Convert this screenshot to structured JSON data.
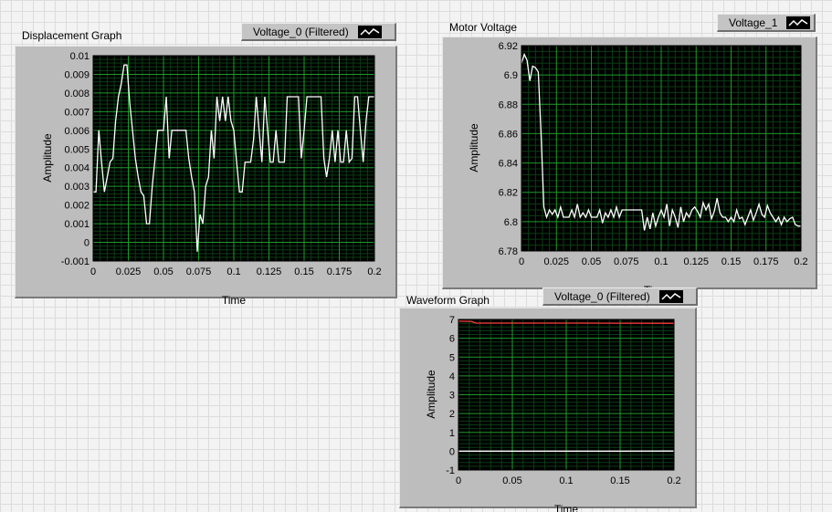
{
  "graphs": [
    {
      "id": "displacement",
      "title": "Displacement Graph",
      "legend_label": "Voltage_0 (Filtered)",
      "xlabel": "Time",
      "ylabel": "Amplitude",
      "xlim": [
        0,
        0.2
      ],
      "ylim": [
        -0.001,
        0.01
      ],
      "xticks": [
        "0",
        "0.025",
        "0.05",
        "0.075",
        "0.1",
        "0.125",
        "0.15",
        "0.175",
        "0.2"
      ],
      "yticks": [
        "-0.001",
        "0",
        "0.001",
        "0.002",
        "0.003",
        "0.004",
        "0.005",
        "0.006",
        "0.007",
        "0.008",
        "0.009",
        "0.01"
      ]
    },
    {
      "id": "motor",
      "title": "Motor Voltage",
      "legend_label": "Voltage_1",
      "xlabel": "Time",
      "ylabel": "Amplitude",
      "xlim": [
        0,
        0.2
      ],
      "ylim": [
        6.78,
        6.92
      ],
      "xticks": [
        "0",
        "0.025",
        "0.05",
        "0.075",
        "0.1",
        "0.125",
        "0.15",
        "0.175",
        "0.2"
      ],
      "yticks": [
        "6.78",
        "6.8",
        "6.82",
        "6.84",
        "6.86",
        "6.88",
        "6.9",
        "6.92"
      ]
    },
    {
      "id": "waveform",
      "title": "Waveform Graph",
      "legend_label": "Voltage_0 (Filtered)",
      "xlabel": "Time",
      "ylabel": "Amplitude",
      "xlim": [
        0,
        0.2
      ],
      "ylim": [
        -1,
        7
      ],
      "xticks": [
        "0",
        "0.05",
        "0.1",
        "0.15",
        "0.2"
      ],
      "yticks": [
        "-1",
        "0",
        "1",
        "2",
        "3",
        "4",
        "5",
        "6",
        "7"
      ]
    }
  ],
  "chart_data": [
    {
      "type": "line",
      "title": "Displacement Graph",
      "xlabel": "Time",
      "ylabel": "Amplitude",
      "xlim": [
        0,
        0.2
      ],
      "ylim": [
        -0.001,
        0.01
      ],
      "grid": true,
      "series": [
        {
          "name": "Voltage_0 (Filtered)",
          "color": "#ffffff",
          "x": [
            0,
            0.002,
            0.004,
            0.006,
            0.008,
            0.01,
            0.012,
            0.014,
            0.016,
            0.018,
            0.02,
            0.022,
            0.024,
            0.026,
            0.028,
            0.03,
            0.032,
            0.034,
            0.036,
            0.038,
            0.04,
            0.042,
            0.044,
            0.046,
            0.048,
            0.05,
            0.052,
            0.054,
            0.056,
            0.058,
            0.06,
            0.062,
            0.064,
            0.066,
            0.068,
            0.07,
            0.072,
            0.074,
            0.076,
            0.078,
            0.08,
            0.082,
            0.084,
            0.086,
            0.088,
            0.09,
            0.092,
            0.094,
            0.096,
            0.098,
            0.1,
            0.102,
            0.104,
            0.106,
            0.108,
            0.11,
            0.112,
            0.114,
            0.116,
            0.118,
            0.12,
            0.122,
            0.124,
            0.126,
            0.128,
            0.13,
            0.132,
            0.134,
            0.136,
            0.138,
            0.14,
            0.142,
            0.144,
            0.146,
            0.148,
            0.15,
            0.152,
            0.154,
            0.156,
            0.158,
            0.16,
            0.162,
            0.164,
            0.166,
            0.168,
            0.17,
            0.172,
            0.174,
            0.176,
            0.178,
            0.18,
            0.182,
            0.184,
            0.186,
            0.188,
            0.19,
            0.192,
            0.194,
            0.196,
            0.198,
            0.2
          ],
          "values": [
            0.0027,
            0.0027,
            0.006,
            0.0043,
            0.0027,
            0.0035,
            0.0043,
            0.0045,
            0.0065,
            0.0078,
            0.0085,
            0.0095,
            0.0095,
            0.0075,
            0.006,
            0.0045,
            0.0035,
            0.0027,
            0.0025,
            0.001,
            0.001,
            0.003,
            0.0045,
            0.006,
            0.006,
            0.006,
            0.0078,
            0.0045,
            0.006,
            0.006,
            0.006,
            0.006,
            0.006,
            0.006,
            0.0045,
            0.0035,
            0.0027,
            -0.0005,
            0.0015,
            0.001,
            0.003,
            0.0035,
            0.006,
            0.0045,
            0.0078,
            0.0065,
            0.0078,
            0.0065,
            0.0078,
            0.0065,
            0.006,
            0.0043,
            0.0027,
            0.0027,
            0.0043,
            0.0043,
            0.0043,
            0.0055,
            0.0078,
            0.006,
            0.0043,
            0.0078,
            0.006,
            0.0043,
            0.0043,
            0.006,
            0.0043,
            0.0043,
            0.0043,
            0.0078,
            0.0078,
            0.0078,
            0.0078,
            0.0078,
            0.0045,
            0.006,
            0.0078,
            0.0078,
            0.0078,
            0.0078,
            0.0078,
            0.0078,
            0.0045,
            0.0035,
            0.0045,
            0.006,
            0.0043,
            0.006,
            0.0043,
            0.0043,
            0.006,
            0.0043,
            0.0045,
            0.0078,
            0.0078,
            0.006,
            0.0043,
            0.0065,
            0.0078,
            0.0078,
            0.0078
          ]
        }
      ]
    },
    {
      "type": "line",
      "title": "Motor Voltage",
      "xlabel": "Time",
      "ylabel": "Amplitude",
      "xlim": [
        0,
        0.2
      ],
      "ylim": [
        6.78,
        6.92
      ],
      "grid": true,
      "series": [
        {
          "name": "Voltage_1",
          "color": "#ffffff",
          "x": [
            0,
            0.002,
            0.004,
            0.006,
            0.008,
            0.01,
            0.012,
            0.014,
            0.016,
            0.018,
            0.02,
            0.022,
            0.024,
            0.026,
            0.028,
            0.03,
            0.032,
            0.034,
            0.036,
            0.038,
            0.04,
            0.042,
            0.044,
            0.046,
            0.048,
            0.05,
            0.052,
            0.054,
            0.056,
            0.058,
            0.06,
            0.062,
            0.064,
            0.066,
            0.068,
            0.07,
            0.072,
            0.074,
            0.076,
            0.078,
            0.08,
            0.082,
            0.084,
            0.086,
            0.088,
            0.09,
            0.092,
            0.094,
            0.096,
            0.098,
            0.1,
            0.102,
            0.104,
            0.106,
            0.108,
            0.11,
            0.112,
            0.114,
            0.116,
            0.118,
            0.12,
            0.122,
            0.124,
            0.126,
            0.128,
            0.13,
            0.132,
            0.134,
            0.136,
            0.138,
            0.14,
            0.142,
            0.144,
            0.146,
            0.148,
            0.15,
            0.152,
            0.154,
            0.156,
            0.158,
            0.16,
            0.162,
            0.164,
            0.166,
            0.168,
            0.17,
            0.172,
            0.174,
            0.176,
            0.178,
            0.18,
            0.182,
            0.184,
            0.186,
            0.188,
            0.19,
            0.192,
            0.194,
            0.196,
            0.198,
            0.2
          ],
          "values": [
            6.908,
            6.914,
            6.91,
            6.896,
            6.906,
            6.905,
            6.902,
            6.86,
            6.81,
            6.803,
            6.808,
            6.805,
            6.808,
            6.803,
            6.81,
            6.803,
            6.803,
            6.803,
            6.808,
            6.803,
            6.812,
            6.803,
            6.806,
            6.803,
            6.808,
            6.803,
            6.803,
            6.803,
            6.808,
            6.799,
            6.806,
            6.803,
            6.808,
            6.803,
            6.81,
            6.803,
            6.808,
            6.808,
            6.808,
            6.808,
            6.808,
            6.808,
            6.808,
            6.808,
            6.794,
            6.803,
            6.795,
            6.806,
            6.797,
            6.803,
            6.808,
            6.803,
            6.812,
            6.797,
            6.808,
            6.803,
            6.796,
            6.81,
            6.8,
            6.806,
            6.803,
            6.808,
            6.81,
            6.807,
            6.803,
            6.813,
            6.808,
            6.812,
            6.802,
            6.807,
            6.816,
            6.806,
            6.803,
            6.803,
            6.8,
            6.803,
            6.8,
            6.808,
            6.802,
            6.803,
            6.798,
            6.803,
            6.808,
            6.801,
            6.806,
            6.812,
            6.805,
            6.803,
            6.811,
            6.806,
            6.803,
            6.8,
            6.803,
            6.798,
            6.803,
            6.8,
            6.802,
            6.803,
            6.798,
            6.797,
            6.797
          ]
        }
      ]
    },
    {
      "type": "line",
      "title": "Waveform Graph",
      "xlabel": "Time",
      "ylabel": "Amplitude",
      "xlim": [
        0,
        0.2
      ],
      "ylim": [
        -1,
        7
      ],
      "grid": true,
      "series": [
        {
          "name": "Voltage_0 (Filtered)",
          "color": "#ffffff",
          "x": [
            0,
            0.05,
            0.1,
            0.15,
            0.2
          ],
          "values": [
            0.005,
            0.006,
            0.006,
            0.006,
            0.0078
          ]
        },
        {
          "color": "#ff3b3b",
          "x": [
            0,
            0.012,
            0.016,
            0.05,
            0.1,
            0.15,
            0.2
          ],
          "values": [
            6.91,
            6.9,
            6.808,
            6.806,
            6.805,
            6.803,
            6.797
          ]
        }
      ]
    }
  ],
  "colors": {
    "plot_background": "#000000",
    "grid_major": "#1c9a2a",
    "grid_minor": "#0b3d14",
    "trace_primary": "#ffffff",
    "trace_secondary": "#ff3b3b",
    "frame": "#bdbdbd"
  },
  "icons": {
    "legend_swatch": "line-plot-icon"
  }
}
